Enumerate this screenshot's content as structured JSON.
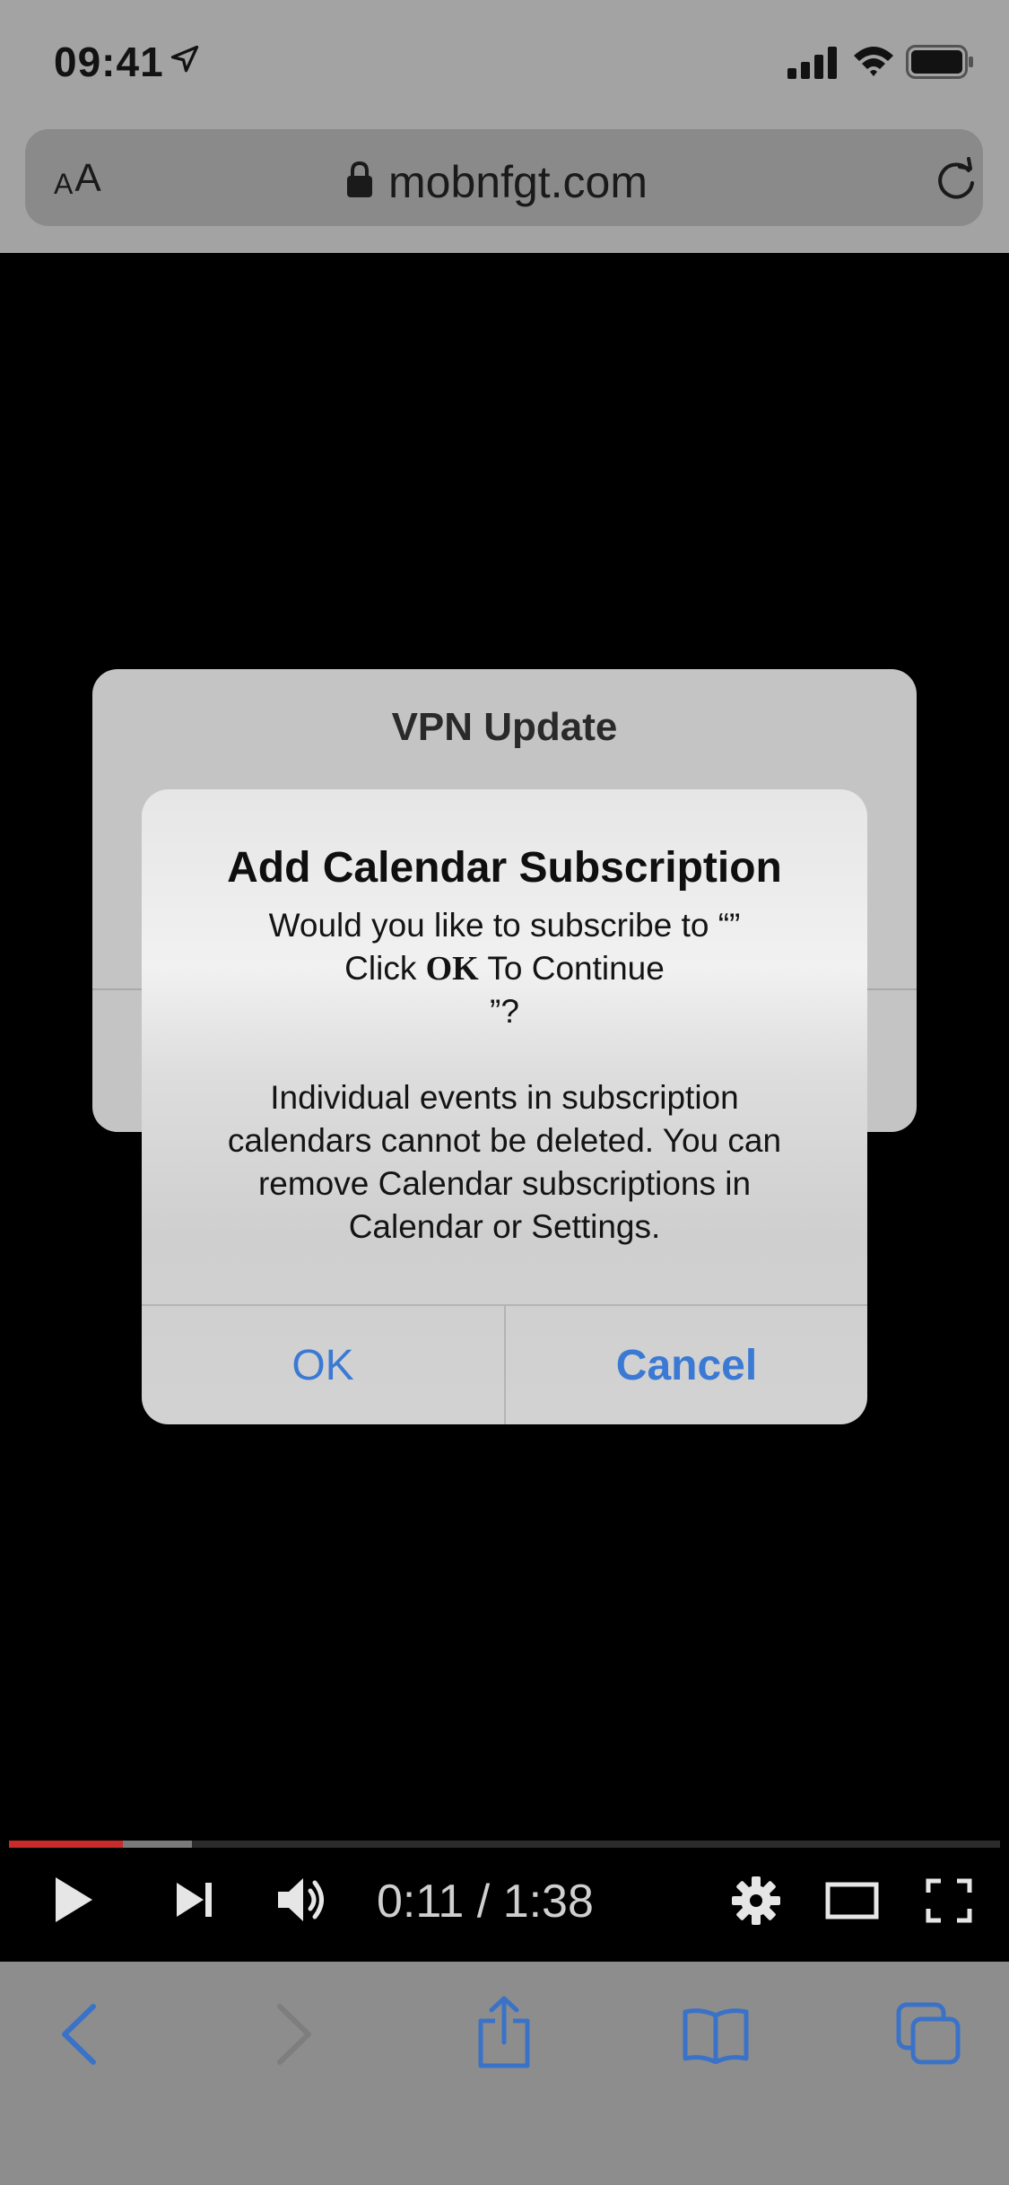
{
  "status_bar": {
    "time": "09:41"
  },
  "url_bar": {
    "text_size_small": "A",
    "text_size_large": "A",
    "url": "mobnfgt.com"
  },
  "background_dialog": {
    "title": "VPN Update"
  },
  "alert": {
    "title": "Add Calendar Subscription",
    "message_line_1": "Would you like to subscribe to “”",
    "message_line_2_prefix": "Click ",
    "message_line_2_bold": "OK",
    "message_line_2_suffix": " To Continue",
    "message_line_3": "”?",
    "info_line_1": "Individual events in subscription",
    "info_line_2": "calendars cannot be deleted. You can",
    "info_line_3": "remove Calendar subscriptions in",
    "info_line_4": "Calendar or Settings.",
    "ok_label": "OK",
    "cancel_label": "Cancel"
  },
  "video_player": {
    "time_display": "0:11 / 1:38",
    "played_fraction": 0.115,
    "current_seconds": 11,
    "duration_seconds": 98,
    "buffered_fraction": 0.185
  },
  "colors": {
    "accent": "#3a7ad4",
    "progress_played": "#c92a2a"
  },
  "icons": {
    "status": [
      "location-arrow-icon",
      "cellular-signal-icon",
      "wifi-icon",
      "battery-icon"
    ],
    "url_bar": [
      "lock-icon",
      "reload-icon"
    ],
    "video": [
      "play-icon",
      "next-icon",
      "volume-icon",
      "settings-icon",
      "theater-mode-icon",
      "fullscreen-icon"
    ],
    "toolbar": [
      "back-icon",
      "forward-icon",
      "share-icon",
      "bookmarks-icon",
      "tabs-icon"
    ]
  }
}
